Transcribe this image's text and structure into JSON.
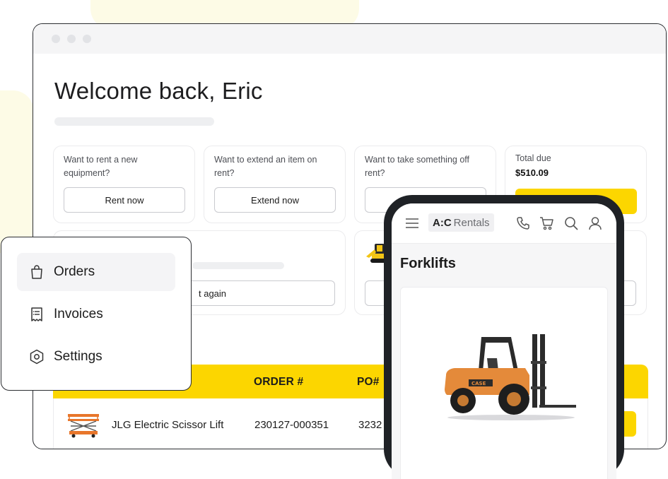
{
  "welcome": {
    "title": "Welcome back, Eric"
  },
  "cards": {
    "rent": {
      "text": "Want to rent a new equipment?",
      "button": "Rent now"
    },
    "extend": {
      "text": "Want to extend an item on rent?",
      "button": "Extend now"
    },
    "offrent": {
      "text": "Want to take something off rent?",
      "button": ""
    },
    "total": {
      "label": "Total due",
      "value": "$510.09"
    },
    "reorder": {
      "button_partial": "t again"
    }
  },
  "table": {
    "headers": [
      "ORDER #",
      "PO#"
    ],
    "rows": [
      {
        "item": "JLG Electric Scissor Lift",
        "order": "230127-000351",
        "po": "3232"
      }
    ]
  },
  "sidebar": {
    "items": [
      {
        "label": "Orders",
        "icon": "shopping-bag-icon",
        "active": true
      },
      {
        "label": "Invoices",
        "icon": "receipt-icon",
        "active": false
      },
      {
        "label": "Settings",
        "icon": "hexagon-settings-icon",
        "active": false
      }
    ]
  },
  "phone": {
    "brand_bold": "A:C",
    "brand_light": "Rentals",
    "section_title": "Forklifts",
    "header_icons": [
      "menu-icon",
      "phone-icon",
      "cart-icon",
      "search-icon",
      "user-icon"
    ]
  },
  "colors": {
    "accent": "#fcd600",
    "frame": "#2b2d31",
    "skeleton": "#eeeff1"
  }
}
